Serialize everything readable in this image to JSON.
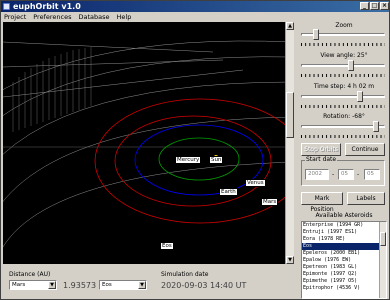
{
  "window": {
    "title": "euphOrbit v1.0"
  },
  "menu": [
    "Project",
    "Preferences",
    "Database",
    "Help"
  ],
  "viewport": {
    "labels": {
      "mercury": "Mercury",
      "sun": "Sun",
      "earth": "Earth",
      "venus": "Venus",
      "mars": "Mars",
      "eos": "Eos"
    },
    "colors": {
      "background": "#000000",
      "grid": "#909090",
      "mercury_orbit": "#00a000",
      "venus_orbit": "#0000ff",
      "earth_orbit": "#d40000",
      "mars_orbit": "#d40000"
    }
  },
  "controls": {
    "zoom_label": "Zoom",
    "zoom_level": 0.15,
    "view_angle_label": "View angle: 25°",
    "view_angle_level": 0.6,
    "time_step_label": "Time step: 4 h 02 m",
    "time_step_level": 0.72,
    "rotation_label": "Rotation: -68°",
    "rotation_level": 0.92,
    "stop_button": "Stop Orbits",
    "continue_button": "Continue",
    "start_date_label": "Start date",
    "start_date": {
      "year": "2002",
      "month": "05",
      "day": "05",
      "sep": "-"
    },
    "mark_position_button": "Mark Position",
    "labels_button": "Labels",
    "asteroids_label": "Available Asteroids",
    "asteroids": [
      "Enterprise (1994 GR)",
      "Entruji (1997 ES1)",
      "Eora (1978 RE)",
      "Eos",
      "Epeleros (2000 EB1)",
      "Epalow (1976 EW)",
      "Epetreon (1983 GL)",
      "Epimonte (1997 Q2)",
      "Epimethe (1997 O5)",
      "Epitrophor (4536 V)"
    ],
    "selected_asteroid_index": 3
  },
  "bottom": {
    "distance_label": "Distance (AU)",
    "from_body": "Mars",
    "distance_value": "1.93573",
    "to_body": "Eos",
    "sim_date_label": "Simulation date",
    "sim_date_value": "2020-09-03 14:40 UT"
  }
}
